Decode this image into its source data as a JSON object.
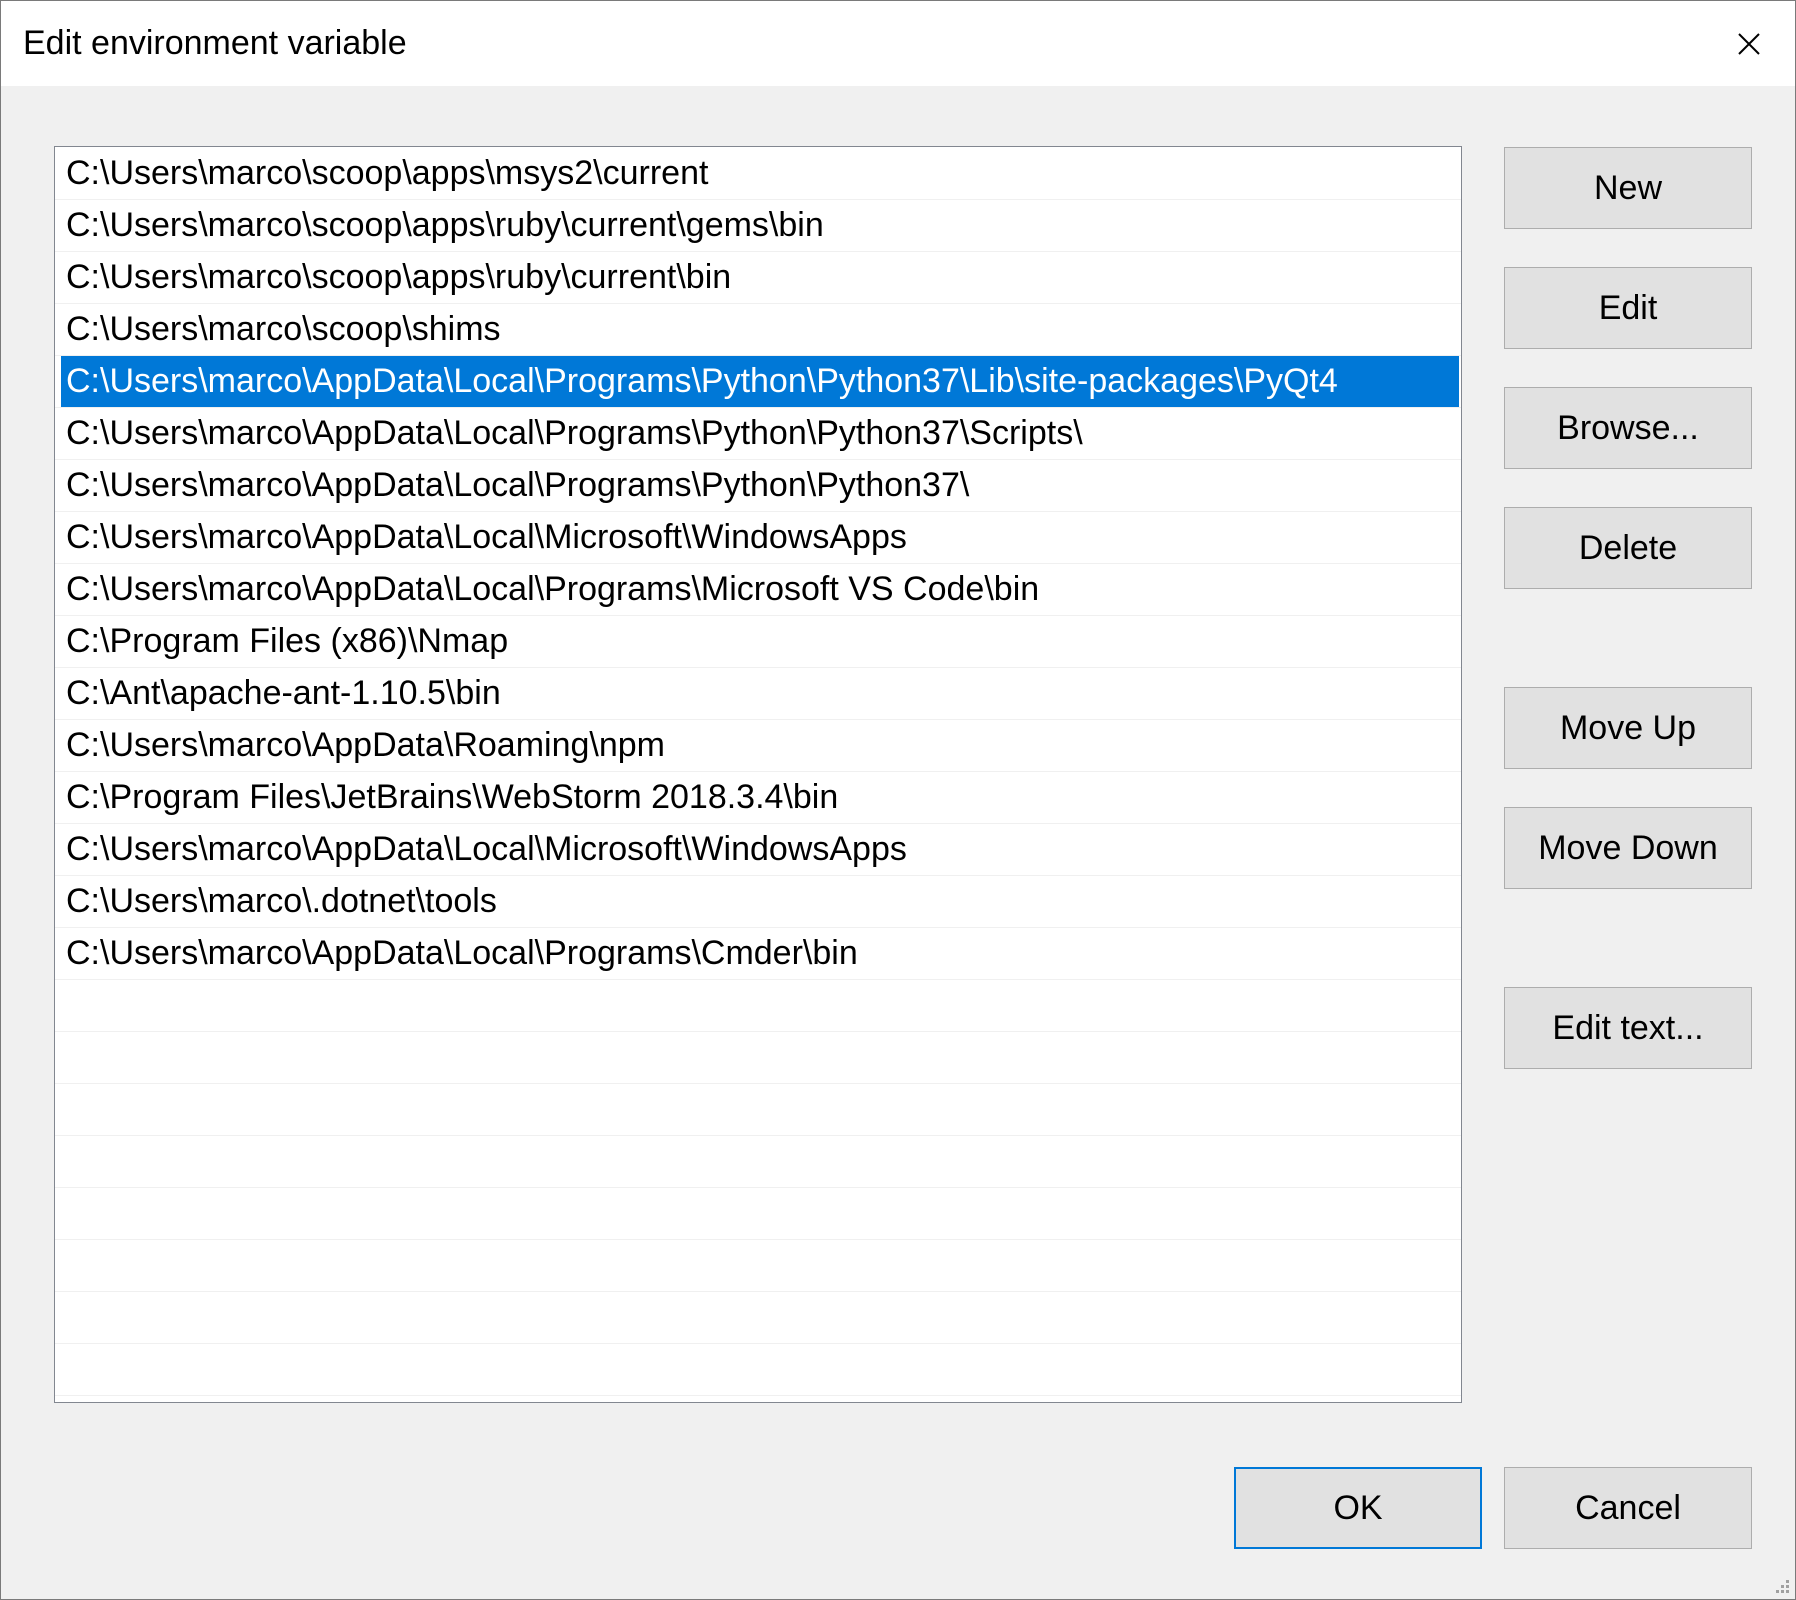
{
  "window": {
    "title": "Edit environment variable",
    "close_icon": "close-icon"
  },
  "list": {
    "selected_index": 4,
    "items": [
      "C:\\Users\\marco\\scoop\\apps\\msys2\\current",
      "C:\\Users\\marco\\scoop\\apps\\ruby\\current\\gems\\bin",
      "C:\\Users\\marco\\scoop\\apps\\ruby\\current\\bin",
      "C:\\Users\\marco\\scoop\\shims",
      "C:\\Users\\marco\\AppData\\Local\\Programs\\Python\\Python37\\Lib\\site-packages\\PyQt4",
      "C:\\Users\\marco\\AppData\\Local\\Programs\\Python\\Python37\\Scripts\\",
      "C:\\Users\\marco\\AppData\\Local\\Programs\\Python\\Python37\\",
      "C:\\Users\\marco\\AppData\\Local\\Microsoft\\WindowsApps",
      "C:\\Users\\marco\\AppData\\Local\\Programs\\Microsoft VS Code\\bin",
      "C:\\Program Files (x86)\\Nmap",
      "C:\\Ant\\apache-ant-1.10.5\\bin",
      "C:\\Users\\marco\\AppData\\Roaming\\npm",
      "C:\\Program Files\\JetBrains\\WebStorm 2018.3.4\\bin",
      "C:\\Users\\marco\\AppData\\Local\\Microsoft\\WindowsApps",
      "C:\\Users\\marco\\.dotnet\\tools",
      "C:\\Users\\marco\\AppData\\Local\\Programs\\Cmder\\bin",
      "",
      "",
      "",
      "",
      "",
      "",
      "",
      "",
      ""
    ]
  },
  "buttons": {
    "new": "New",
    "edit": "Edit",
    "browse": "Browse...",
    "delete": "Delete",
    "move_up": "Move Up",
    "move_down": "Move Down",
    "edit_text": "Edit text...",
    "ok": "OK",
    "cancel": "Cancel"
  },
  "colors": {
    "selection": "#0078d7",
    "dialog_bg": "#f0f0f0",
    "button_bg": "#e1e1e1"
  }
}
